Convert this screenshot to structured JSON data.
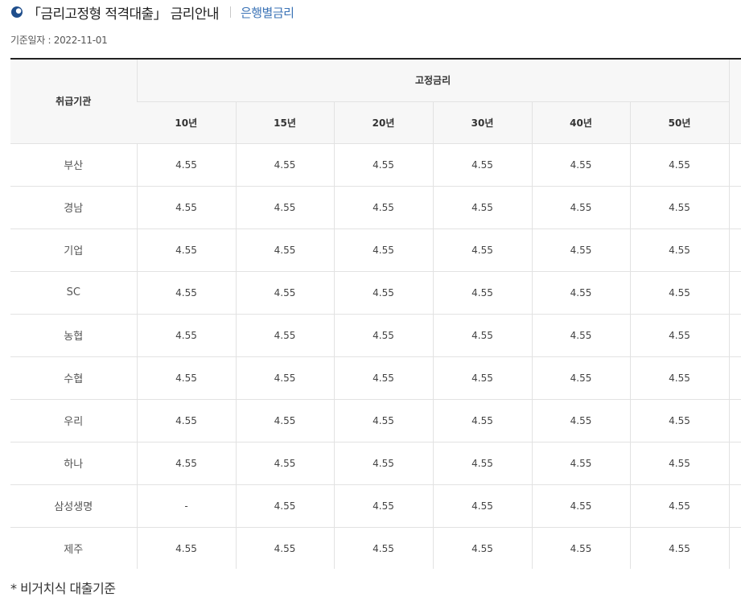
{
  "header": {
    "title": "「금리고정형 적격대출」 금리안내",
    "link_label": "은행별금리"
  },
  "base_date": "기준일자 : 2022-11-01",
  "table": {
    "institution_header": "취급기관",
    "group_header": "고정금리",
    "period_headers": [
      "10년",
      "15년",
      "20년",
      "30년",
      "40년",
      "50년"
    ],
    "rows": [
      {
        "institution": "부산",
        "rates": [
          "4.55",
          "4.55",
          "4.55",
          "4.55",
          "4.55",
          "4.55"
        ]
      },
      {
        "institution": "경남",
        "rates": [
          "4.55",
          "4.55",
          "4.55",
          "4.55",
          "4.55",
          "4.55"
        ]
      },
      {
        "institution": "기업",
        "rates": [
          "4.55",
          "4.55",
          "4.55",
          "4.55",
          "4.55",
          "4.55"
        ]
      },
      {
        "institution": "SC",
        "rates": [
          "4.55",
          "4.55",
          "4.55",
          "4.55",
          "4.55",
          "4.55"
        ]
      },
      {
        "institution": "농협",
        "rates": [
          "4.55",
          "4.55",
          "4.55",
          "4.55",
          "4.55",
          "4.55"
        ]
      },
      {
        "institution": "수협",
        "rates": [
          "4.55",
          "4.55",
          "4.55",
          "4.55",
          "4.55",
          "4.55"
        ]
      },
      {
        "institution": "우리",
        "rates": [
          "4.55",
          "4.55",
          "4.55",
          "4.55",
          "4.55",
          "4.55"
        ]
      },
      {
        "institution": "하나",
        "rates": [
          "4.55",
          "4.55",
          "4.55",
          "4.55",
          "4.55",
          "4.55"
        ]
      },
      {
        "institution": "삼성생명",
        "rates": [
          "-",
          "4.55",
          "4.55",
          "4.55",
          "4.55",
          "4.55"
        ]
      },
      {
        "institution": "제주",
        "rates": [
          "4.55",
          "4.55",
          "4.55",
          "4.55",
          "4.55",
          "4.55"
        ]
      }
    ]
  },
  "footnote": "* 비거치식 대출기준"
}
